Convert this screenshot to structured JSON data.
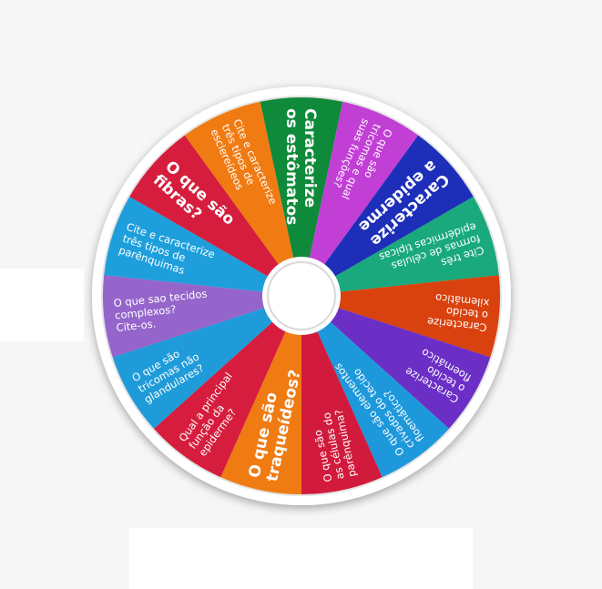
{
  "wheel": {
    "center": "",
    "segments": [
      {
        "lines": [
          "Caracterize",
          "os estômatos"
        ],
        "color": "#0f8a3a",
        "big": true
      },
      {
        "lines": [
          "O que são",
          "tricomas e qual",
          "suas funções?"
        ],
        "color": "#c23fd6",
        "big": false
      },
      {
        "lines": [
          "Caracterize",
          "a epiderme"
        ],
        "color": "#1d2fb9",
        "big": true
      },
      {
        "lines": [
          "Cite três",
          "formas de células",
          "epidérmicas típicas"
        ],
        "color": "#19a97c",
        "big": false
      },
      {
        "lines": [
          "Caracterize",
          "o tecido",
          "xilemático"
        ],
        "color": "#d9420f",
        "big": false
      },
      {
        "lines": [
          "Caracterize",
          "o tecido",
          "floemático"
        ],
        "color": "#6b2fc6",
        "big": false
      },
      {
        "lines": [
          "O que são elementos",
          "crivados do tecido",
          "floemático?"
        ],
        "color": "#1d98db",
        "big": false
      },
      {
        "lines": [
          "O que são",
          "as células do",
          "parênquima?"
        ],
        "color": "#d11a3c",
        "big": false
      },
      {
        "lines": [
          "O que são",
          "traqueídeos?"
        ],
        "color": "#f07b12",
        "big": true
      },
      {
        "lines": [
          "Qual a principal",
          "função da",
          "epiderme?"
        ],
        "color": "#d61d3d",
        "big": false
      },
      {
        "lines": [
          "O que são",
          "tricomas não",
          "glandulares?"
        ],
        "color": "#1f9bd9",
        "big": false
      },
      {
        "lines": [
          "O que sao tecidos",
          "complexos?",
          "Cite-os."
        ],
        "color": "#9565cb",
        "big": false
      },
      {
        "lines": [
          "Cite e caracterize",
          "três tipos de",
          "parênquimas"
        ],
        "color": "#1e9fdc",
        "big": false
      },
      {
        "lines": [
          "O que são",
          "fibras?"
        ],
        "color": "#d61d3d",
        "big": true
      },
      {
        "lines": [
          "Cite e caracterize",
          "três tipos de",
          "esclereídeos"
        ],
        "color": "#f07b12",
        "big": false
      }
    ]
  }
}
